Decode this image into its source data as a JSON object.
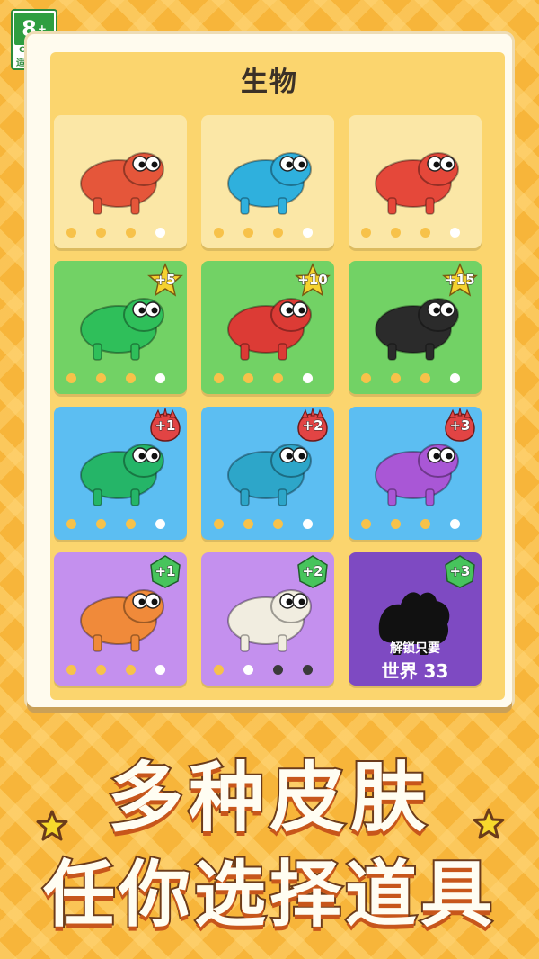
{
  "age_rating": {
    "number": "8",
    "plus": "+",
    "org": "CADPA",
    "tip": "适龄提示"
  },
  "panel": {
    "title": "生物"
  },
  "cards": [
    {
      "id": "c1",
      "creature": "red-horned-beast",
      "style": "locked-palette",
      "color": "#e5563a",
      "badge": null,
      "dots": [
        "#f7c24a",
        "#f7c24a",
        "#f7c24a",
        "#ffffff"
      ]
    },
    {
      "id": "c2",
      "creature": "blue-crab",
      "style": "locked-palette",
      "color": "#2fb0dd",
      "badge": null,
      "dots": [
        "#f7c24a",
        "#f7c24a",
        "#f7c24a",
        "#ffffff"
      ]
    },
    {
      "id": "c3",
      "creature": "red-skeleton-dino",
      "style": "locked-palette",
      "color": "#e5483a",
      "badge": null,
      "dots": [
        "#f7c24a",
        "#f7c24a",
        "#f7c24a",
        "#ffffff"
      ]
    },
    {
      "id": "c4",
      "creature": "green-lizard",
      "style": "green",
      "color": "#2fbf5a",
      "badge": {
        "text": "+5",
        "icon": "star-icon",
        "color": "#f5d22f"
      },
      "dots": [
        "#f7c24a",
        "#f7c24a",
        "#f7c24a",
        "#ffffff"
      ]
    },
    {
      "id": "c5",
      "creature": "red-lion-beast",
      "style": "green",
      "color": "#dc3b35",
      "badge": {
        "text": "+10",
        "icon": "star-icon",
        "color": "#f5d22f"
      },
      "dots": [
        "#f7c24a",
        "#f7c24a",
        "#f7c24a",
        "#ffffff"
      ]
    },
    {
      "id": "c6",
      "creature": "black-white-spider",
      "style": "green",
      "color": "#2b2b2b",
      "badge": {
        "text": "+15",
        "icon": "star-icon",
        "color": "#f5d22f"
      },
      "dots": [
        "#f7c24a",
        "#f7c24a",
        "#f7c24a",
        "#ffffff"
      ]
    },
    {
      "id": "c7",
      "creature": "green-cat",
      "style": "blue",
      "color": "#25b568",
      "badge": {
        "text": "+1",
        "icon": "paw-icon",
        "color": "#e24444"
      },
      "dots": [
        "#f7c24a",
        "#f7c24a",
        "#f7c24a",
        "#ffffff"
      ]
    },
    {
      "id": "c8",
      "creature": "blue-scorpion",
      "style": "blue",
      "color": "#2da6c9",
      "badge": {
        "text": "+2",
        "icon": "paw-icon",
        "color": "#e24444"
      },
      "dots": [
        "#f7c24a",
        "#f7c24a",
        "#f7c24a",
        "#ffffff"
      ]
    },
    {
      "id": "c9",
      "creature": "purple-dino",
      "style": "blue",
      "color": "#a957d6",
      "badge": {
        "text": "+3",
        "icon": "paw-icon",
        "color": "#e24444"
      },
      "dots": [
        "#f7c24a",
        "#f7c24a",
        "#f7c24a",
        "#ffffff"
      ]
    },
    {
      "id": "c10",
      "creature": "orange-octopus",
      "style": "purple",
      "color": "#f08a3a",
      "badge": {
        "text": "+1",
        "icon": "gem-icon",
        "color": "#47c45c"
      },
      "dots": [
        "#f7c24a",
        "#f7c24a",
        "#f7c24a",
        "#ffffff"
      ]
    },
    {
      "id": "c11",
      "creature": "white-snake",
      "style": "purple",
      "color": "#f1ede0",
      "badge": {
        "text": "+2",
        "icon": "gem-icon",
        "color": "#47c45c"
      },
      "dots": [
        "#f7c24a",
        "#ffffff",
        "#3a3a3a",
        "#3a3a3a"
      ]
    },
    {
      "id": "c12",
      "creature": "locked-silhouette",
      "style": "dark",
      "color": "#111111",
      "badge": {
        "text": "+3",
        "icon": "gem-icon",
        "color": "#47c45c"
      },
      "locked": {
        "line1": "解锁只要",
        "line2": "世界 33"
      }
    }
  ],
  "banner": {
    "line1": "多种皮肤",
    "line2": "任你选择道具",
    "star_color": "#f7d92c"
  }
}
